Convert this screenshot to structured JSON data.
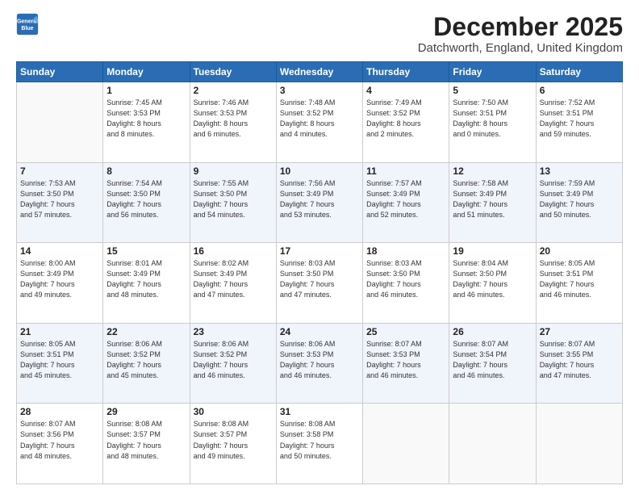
{
  "header": {
    "logo_line1": "General",
    "logo_line2": "Blue",
    "month_title": "December 2025",
    "location": "Datchworth, England, United Kingdom"
  },
  "weekdays": [
    "Sunday",
    "Monday",
    "Tuesday",
    "Wednesday",
    "Thursday",
    "Friday",
    "Saturday"
  ],
  "weeks": [
    [
      {
        "day": "",
        "info": ""
      },
      {
        "day": "1",
        "info": "Sunrise: 7:45 AM\nSunset: 3:53 PM\nDaylight: 8 hours\nand 8 minutes."
      },
      {
        "day": "2",
        "info": "Sunrise: 7:46 AM\nSunset: 3:53 PM\nDaylight: 8 hours\nand 6 minutes."
      },
      {
        "day": "3",
        "info": "Sunrise: 7:48 AM\nSunset: 3:52 PM\nDaylight: 8 hours\nand 4 minutes."
      },
      {
        "day": "4",
        "info": "Sunrise: 7:49 AM\nSunset: 3:52 PM\nDaylight: 8 hours\nand 2 minutes."
      },
      {
        "day": "5",
        "info": "Sunrise: 7:50 AM\nSunset: 3:51 PM\nDaylight: 8 hours\nand 0 minutes."
      },
      {
        "day": "6",
        "info": "Sunrise: 7:52 AM\nSunset: 3:51 PM\nDaylight: 7 hours\nand 59 minutes."
      }
    ],
    [
      {
        "day": "7",
        "info": "Sunrise: 7:53 AM\nSunset: 3:50 PM\nDaylight: 7 hours\nand 57 minutes."
      },
      {
        "day": "8",
        "info": "Sunrise: 7:54 AM\nSunset: 3:50 PM\nDaylight: 7 hours\nand 56 minutes."
      },
      {
        "day": "9",
        "info": "Sunrise: 7:55 AM\nSunset: 3:50 PM\nDaylight: 7 hours\nand 54 minutes."
      },
      {
        "day": "10",
        "info": "Sunrise: 7:56 AM\nSunset: 3:49 PM\nDaylight: 7 hours\nand 53 minutes."
      },
      {
        "day": "11",
        "info": "Sunrise: 7:57 AM\nSunset: 3:49 PM\nDaylight: 7 hours\nand 52 minutes."
      },
      {
        "day": "12",
        "info": "Sunrise: 7:58 AM\nSunset: 3:49 PM\nDaylight: 7 hours\nand 51 minutes."
      },
      {
        "day": "13",
        "info": "Sunrise: 7:59 AM\nSunset: 3:49 PM\nDaylight: 7 hours\nand 50 minutes."
      }
    ],
    [
      {
        "day": "14",
        "info": "Sunrise: 8:00 AM\nSunset: 3:49 PM\nDaylight: 7 hours\nand 49 minutes."
      },
      {
        "day": "15",
        "info": "Sunrise: 8:01 AM\nSunset: 3:49 PM\nDaylight: 7 hours\nand 48 minutes."
      },
      {
        "day": "16",
        "info": "Sunrise: 8:02 AM\nSunset: 3:49 PM\nDaylight: 7 hours\nand 47 minutes."
      },
      {
        "day": "17",
        "info": "Sunrise: 8:03 AM\nSunset: 3:50 PM\nDaylight: 7 hours\nand 47 minutes."
      },
      {
        "day": "18",
        "info": "Sunrise: 8:03 AM\nSunset: 3:50 PM\nDaylight: 7 hours\nand 46 minutes."
      },
      {
        "day": "19",
        "info": "Sunrise: 8:04 AM\nSunset: 3:50 PM\nDaylight: 7 hours\nand 46 minutes."
      },
      {
        "day": "20",
        "info": "Sunrise: 8:05 AM\nSunset: 3:51 PM\nDaylight: 7 hours\nand 46 minutes."
      }
    ],
    [
      {
        "day": "21",
        "info": "Sunrise: 8:05 AM\nSunset: 3:51 PM\nDaylight: 7 hours\nand 45 minutes."
      },
      {
        "day": "22",
        "info": "Sunrise: 8:06 AM\nSunset: 3:52 PM\nDaylight: 7 hours\nand 45 minutes."
      },
      {
        "day": "23",
        "info": "Sunrise: 8:06 AM\nSunset: 3:52 PM\nDaylight: 7 hours\nand 46 minutes."
      },
      {
        "day": "24",
        "info": "Sunrise: 8:06 AM\nSunset: 3:53 PM\nDaylight: 7 hours\nand 46 minutes."
      },
      {
        "day": "25",
        "info": "Sunrise: 8:07 AM\nSunset: 3:53 PM\nDaylight: 7 hours\nand 46 minutes."
      },
      {
        "day": "26",
        "info": "Sunrise: 8:07 AM\nSunset: 3:54 PM\nDaylight: 7 hours\nand 46 minutes."
      },
      {
        "day": "27",
        "info": "Sunrise: 8:07 AM\nSunset: 3:55 PM\nDaylight: 7 hours\nand 47 minutes."
      }
    ],
    [
      {
        "day": "28",
        "info": "Sunrise: 8:07 AM\nSunset: 3:56 PM\nDaylight: 7 hours\nand 48 minutes."
      },
      {
        "day": "29",
        "info": "Sunrise: 8:08 AM\nSunset: 3:57 PM\nDaylight: 7 hours\nand 48 minutes."
      },
      {
        "day": "30",
        "info": "Sunrise: 8:08 AM\nSunset: 3:57 PM\nDaylight: 7 hours\nand 49 minutes."
      },
      {
        "day": "31",
        "info": "Sunrise: 8:08 AM\nSunset: 3:58 PM\nDaylight: 7 hours\nand 50 minutes."
      },
      {
        "day": "",
        "info": ""
      },
      {
        "day": "",
        "info": ""
      },
      {
        "day": "",
        "info": ""
      }
    ]
  ]
}
